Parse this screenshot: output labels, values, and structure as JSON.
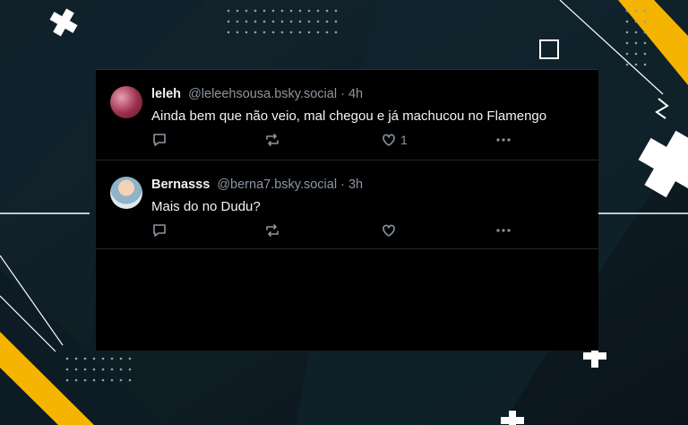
{
  "posts": [
    {
      "display_name": "leleh",
      "handle": "@leleehsousa.bsky.social",
      "time": "· 4h",
      "text": "Ainda bem que não veio, mal chegou e já machucou no Flamengo",
      "like_count": "1",
      "avatar": "avatar-flowers"
    },
    {
      "display_name": "Bernasss",
      "handle": "@berna7.bsky.social",
      "time": "· 3h",
      "text": "Mais do no Dudu?",
      "like_count": "",
      "avatar": "avatar-person"
    }
  ],
  "icons": [
    "reply-icon",
    "repost-icon",
    "like-icon",
    "more-icon"
  ],
  "colors": {
    "background": "#0c1a22",
    "accent_yellow": "#f5b400",
    "card": "#000000",
    "muted_text": "#8c96a1"
  }
}
